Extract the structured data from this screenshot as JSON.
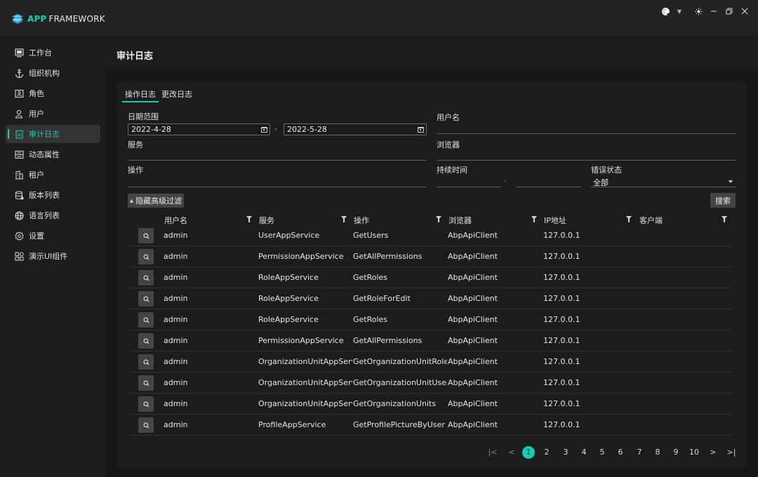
{
  "app": {
    "logo_app": "APP",
    "logo_framework": "FRAMEWORK",
    "accent_color": "#1ec8b4"
  },
  "window_controls": [
    {
      "name": "theme-palette",
      "icon": "palette-icon"
    },
    {
      "name": "theme-dropdown",
      "icon": "chevron-down-icon"
    },
    {
      "name": "brightness",
      "icon": "sun-icon"
    },
    {
      "name": "minimize",
      "icon": "minimize-icon"
    },
    {
      "name": "restore",
      "icon": "restore-icon"
    },
    {
      "name": "close",
      "icon": "close-icon"
    }
  ],
  "sidebar": {
    "items": [
      {
        "label": "工作台",
        "icon": "dashboard-icon",
        "active": false
      },
      {
        "label": "组织机构",
        "icon": "anchor-icon",
        "active": false
      },
      {
        "label": "角色",
        "icon": "role-icon",
        "active": false
      },
      {
        "label": "用户",
        "icon": "user-icon",
        "active": false
      },
      {
        "label": "审计日志",
        "icon": "audit-log-icon",
        "active": true
      },
      {
        "label": "动态属性",
        "icon": "dynamic-property-icon",
        "active": false
      },
      {
        "label": "租户",
        "icon": "tenant-icon",
        "active": false
      },
      {
        "label": "版本列表",
        "icon": "edition-icon",
        "active": false
      },
      {
        "label": "语言列表",
        "icon": "globe-icon",
        "active": false
      },
      {
        "label": "设置",
        "icon": "gear-icon",
        "active": false
      },
      {
        "label": "演示UI组件",
        "icon": "components-icon",
        "active": false
      }
    ]
  },
  "page": {
    "title": "审计日志"
  },
  "tabs": [
    {
      "label": "操作日志",
      "active": true
    },
    {
      "label": "更改日志",
      "active": false
    }
  ],
  "filters": {
    "date_range_label": "日期范围",
    "date_from": "2022-4-28",
    "date_to": "2022-5-28",
    "date_separator": "-",
    "username_label": "用户名",
    "username_value": "",
    "service_label": "服务",
    "service_value": "",
    "browser_label": "浏览器",
    "browser_value": "",
    "operation_label": "操作",
    "operation_value": "",
    "duration_label": "持续时间",
    "duration_from": "",
    "duration_to": "",
    "duration_separator": "-",
    "error_state_label": "错误状态",
    "error_state_value": "全部",
    "toggle_advanced_label": "隐藏高级过滤",
    "search_label": "搜索"
  },
  "table": {
    "columns": [
      "用户名",
      "服务",
      "操作",
      "浏览器",
      "IP地址",
      "客户端"
    ],
    "rows": [
      {
        "user": "admin",
        "service": "UserAppService",
        "operation": "GetUsers",
        "browser": "AbpApiClient",
        "ip": "127.0.0.1",
        "client": ""
      },
      {
        "user": "admin",
        "service": "PermissionAppService",
        "operation": "GetAllPermissions",
        "browser": "AbpApiClient",
        "ip": "127.0.0.1",
        "client": ""
      },
      {
        "user": "admin",
        "service": "RoleAppService",
        "operation": "GetRoles",
        "browser": "AbpApiClient",
        "ip": "127.0.0.1",
        "client": ""
      },
      {
        "user": "admin",
        "service": "RoleAppService",
        "operation": "GetRoleForEdit",
        "browser": "AbpApiClient",
        "ip": "127.0.0.1",
        "client": ""
      },
      {
        "user": "admin",
        "service": "RoleAppService",
        "operation": "GetRoles",
        "browser": "AbpApiClient",
        "ip": "127.0.0.1",
        "client": ""
      },
      {
        "user": "admin",
        "service": "PermissionAppService",
        "operation": "GetAllPermissions",
        "browser": "AbpApiClient",
        "ip": "127.0.0.1",
        "client": ""
      },
      {
        "user": "admin",
        "service": "OrganizationUnitAppService",
        "operation": "GetOrganizationUnitRoles",
        "browser": "AbpApiClient",
        "ip": "127.0.0.1",
        "client": ""
      },
      {
        "user": "admin",
        "service": "OrganizationUnitAppService",
        "operation": "GetOrganizationUnitUsers",
        "browser": "AbpApiClient",
        "ip": "127.0.0.1",
        "client": ""
      },
      {
        "user": "admin",
        "service": "OrganizationUnitAppService",
        "operation": "GetOrganizationUnits",
        "browser": "AbpApiClient",
        "ip": "127.0.0.1",
        "client": ""
      },
      {
        "user": "admin",
        "service": "ProfileAppService",
        "operation": "GetProfilePictureByUser",
        "browser": "AbpApiClient",
        "ip": "127.0.0.1",
        "client": ""
      }
    ]
  },
  "pagination": {
    "pages": [
      "1",
      "2",
      "3",
      "4",
      "5",
      "6",
      "7",
      "8",
      "9",
      "10"
    ],
    "current": "1",
    "first_icon": "first-page-icon",
    "prev_icon": "prev-page-icon",
    "next_icon": "next-page-icon",
    "last_icon": "last-page-icon"
  }
}
